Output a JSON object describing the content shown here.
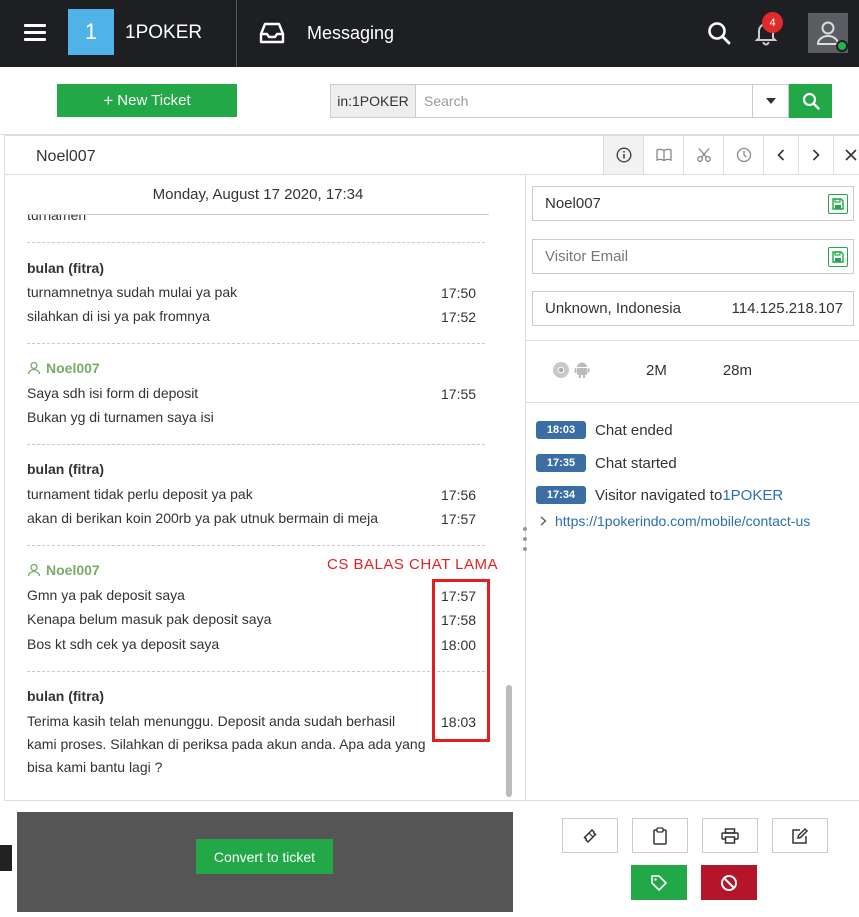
{
  "topbar": {
    "brand_number": "1",
    "brand_name": "1POKER",
    "module_title": "Messaging",
    "notification_count": "4"
  },
  "toolbar": {
    "new_ticket_label": "New Ticket",
    "search_prefix": "in:1POKER",
    "search_placeholder": "Search"
  },
  "chat": {
    "user": "Noel007",
    "date_header": "Monday, August 17 2020, 17:34",
    "cut_text": "turnamen",
    "groups": [
      {
        "sender": "bulan (fitra)",
        "messages": [
          {
            "text": "turnamnetnya sudah mulai ya pak",
            "time": "17:50"
          },
          {
            "text": "silahkan di isi ya pak fromnya",
            "time": "17:52"
          }
        ]
      },
      {
        "sender": "Noel007",
        "messages": [
          {
            "text": "Saya sdh isi form di deposit",
            "time": "17:55"
          },
          {
            "text": "Bukan yg di turnamen saya isi",
            "time": ""
          }
        ]
      },
      {
        "sender": "bulan (fitra)",
        "messages": [
          {
            "text": "turnament tidak perlu deposit ya pak",
            "time": "17:56"
          },
          {
            "text": "akan di berikan koin 200rb ya pak utnuk bermain di meja",
            "time": "17:57"
          }
        ]
      },
      {
        "sender": "Noel007",
        "messages": [
          {
            "text": "Gmn ya pak deposit saya",
            "time": "17:57"
          },
          {
            "text": "Kenapa belum masuk pak deposit saya",
            "time": "17:58"
          },
          {
            "text": "Bos kt sdh cek ya deposit saya",
            "time": "18:00"
          }
        ]
      },
      {
        "sender": "bulan (fitra)",
        "messages": [
          {
            "text": "Terima kasih telah menunggu. Deposit anda sudah berhasil kami proses. Silahkan di periksa pada akun anda. Apa ada yang bisa kami bantu lagi ?",
            "time": "18:03"
          }
        ]
      }
    ],
    "annotation": "CS BALAS CHAT LAMA",
    "convert_label": "Convert to ticket"
  },
  "visitor": {
    "name_value": "Noel007",
    "email_placeholder": "Visitor Email",
    "location": "Unknown, Indonesia",
    "ip": "114.125.218.107",
    "stat_1": "2M",
    "stat_2": "28m",
    "events": [
      {
        "time": "18:03",
        "text": "Chat ended"
      },
      {
        "time": "17:35",
        "text": "Chat started"
      },
      {
        "time": "17:34",
        "text": "Visitor navigated to ",
        "link": "1POKER"
      }
    ],
    "url": "https://1pokerindo.com/mobile/contact-us"
  },
  "colors": {
    "topbar": "#1d1f22",
    "accent_green": "#22a847",
    "logo_blue": "#4fb3e8",
    "visitor_green": "#7aab66",
    "annotation_red": "#e02020",
    "time_badge": "#3a6ea5",
    "block_red": "#b5152b"
  }
}
